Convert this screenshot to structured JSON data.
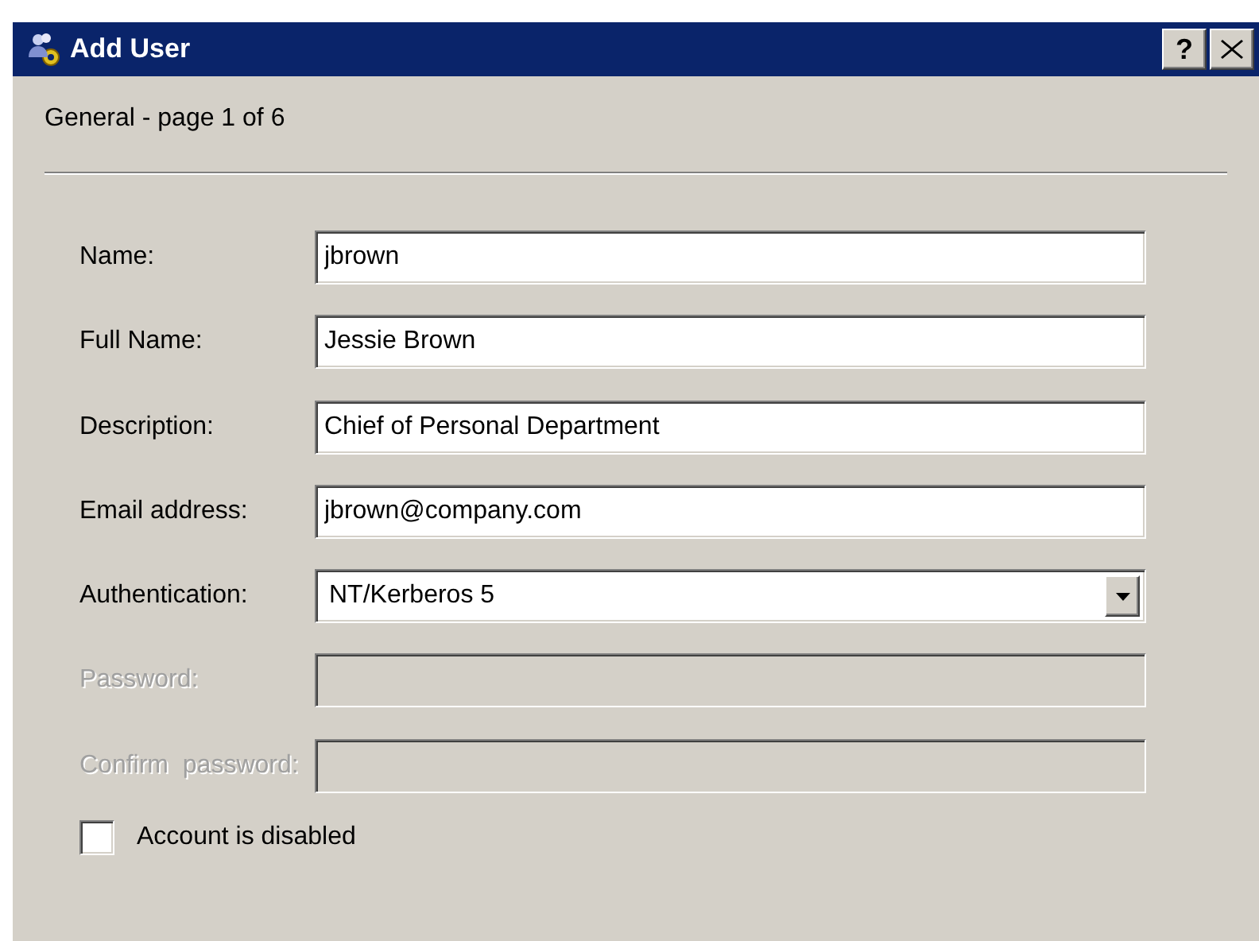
{
  "window": {
    "title": "Add User",
    "help_button": "?"
  },
  "page_header": "General - page 1 of 6",
  "fields": [
    {
      "kind": "text",
      "label": "Name:",
      "value": "jbrown",
      "disabled": false
    },
    {
      "kind": "text",
      "label": "Full Name:",
      "value": "Jessie Brown",
      "disabled": false
    },
    {
      "kind": "text",
      "label": "Description:",
      "value": "Chief of Personal Department",
      "disabled": false
    },
    {
      "kind": "text",
      "label": "Email address:",
      "value": "jbrown@company.com",
      "disabled": false
    },
    {
      "kind": "select",
      "label": "Authentication:",
      "value": "NT/Kerberos 5",
      "disabled": false
    },
    {
      "kind": "text",
      "label": "Password:",
      "disabled": true
    },
    {
      "kind": "text",
      "label": "Confirm  password:",
      "disabled": true
    }
  ],
  "checkbox": {
    "label": "Account is disabled",
    "checked": false
  }
}
